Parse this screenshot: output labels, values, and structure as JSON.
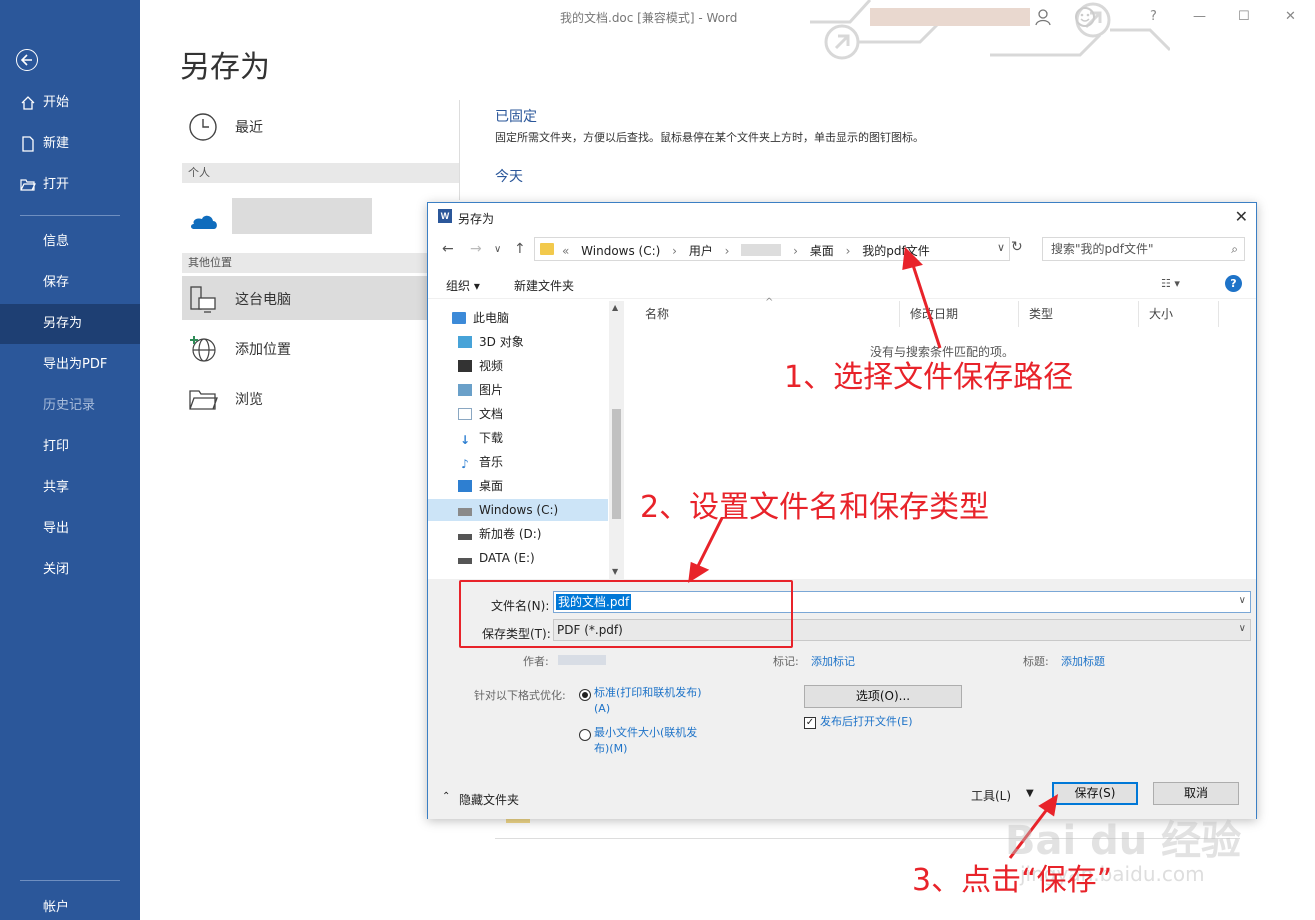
{
  "window": {
    "title": "我的文档.doc [兼容模式] - Word",
    "help": "?",
    "minimize": "—",
    "maximize": "☐",
    "close": "✕"
  },
  "sidebar": {
    "items": [
      {
        "label": "开始",
        "icon": "home-icon"
      },
      {
        "label": "新建",
        "icon": "new-doc-icon"
      },
      {
        "label": "打开",
        "icon": "open-folder-icon"
      },
      {
        "label": "信息"
      },
      {
        "label": "保存"
      },
      {
        "label": "另存为",
        "active": true
      },
      {
        "label": "导出为PDF"
      },
      {
        "label": "历史记录",
        "disabled": true
      },
      {
        "label": "打印"
      },
      {
        "label": "共享"
      },
      {
        "label": "导出"
      },
      {
        "label": "关闭"
      }
    ],
    "account": "帐户"
  },
  "backstage": {
    "title": "另存为",
    "recent": "最近",
    "personal_section": "个人",
    "other_section": "其他位置",
    "this_pc": "这台电脑",
    "add_place": "添加位置",
    "browse": "浏览",
    "pinned_title": "已固定",
    "pinned_desc": "固定所需文件夹，方便以后查找。鼠标悬停在某个文件夹上方时，单击显示的图钉图标。",
    "today_title": "今天"
  },
  "dialog": {
    "title": "另存为",
    "close": "✕",
    "breadcrumbs": [
      "«",
      "Windows (C:)",
      "›",
      "用户",
      "›",
      "›",
      "桌面",
      "›",
      "我的pdf文件"
    ],
    "search_placeholder": "搜索\"我的pdf文件\"",
    "toolbar": {
      "organize": "组织 ▾",
      "new_folder": "新建文件夹",
      "help": "?"
    },
    "tree": [
      {
        "label": "此电脑",
        "icon": "computer-icon",
        "color": "#3c8ad8"
      },
      {
        "label": "3D 对象",
        "icon": "cube-icon",
        "color": "#47a3d8"
      },
      {
        "label": "视频",
        "icon": "video-icon",
        "color": "#333333"
      },
      {
        "label": "图片",
        "icon": "picture-icon",
        "color": "#6aa0c9"
      },
      {
        "label": "文档",
        "icon": "document-icon",
        "color": "#8aa7c2"
      },
      {
        "label": "下载",
        "icon": "download-icon",
        "color": "#2e7fd1"
      },
      {
        "label": "音乐",
        "icon": "music-icon",
        "color": "#2e7fd1"
      },
      {
        "label": "桌面",
        "icon": "desktop-icon",
        "color": "#2e7fd1"
      },
      {
        "label": "Windows (C:)",
        "icon": "drive-icon",
        "color": "#8a8a8a",
        "selected": true
      },
      {
        "label": "新加卷 (D:)",
        "icon": "drive-icon",
        "color": "#555555"
      },
      {
        "label": "DATA (E:)",
        "icon": "drive-icon",
        "color": "#555555"
      }
    ],
    "columns": [
      "名称",
      "修改日期",
      "类型",
      "大小"
    ],
    "empty_message": "没有与搜索条件匹配的项。",
    "filename_label": "文件名(N):",
    "filename_value": "我的文档.pdf",
    "filetype_label": "保存类型(T):",
    "filetype_value": "PDF (*.pdf)",
    "author_label": "作者:",
    "tags_label": "标记:",
    "tags_link": "添加标记",
    "title_label": "标题:",
    "title_link": "添加标题",
    "optimize_label": "针对以下格式优化:",
    "opt_standard_1": "标准(打印和联机发布)",
    "opt_standard_2": "(A)",
    "opt_min_1": "最小文件大小(联机发",
    "opt_min_2": "布)(M)",
    "options_button": "选项(O)...",
    "open_after": "发布后打开文件(E)",
    "hide_folders": "隐藏文件夹",
    "tools": "工具(L)",
    "save": "保存(S)",
    "cancel": "取消"
  },
  "annotations": {
    "step1": "1、选择文件保存路径",
    "step2": "2、设置文件名和保存类型",
    "step3": "3、点击“保存”",
    "watermark": "Bai du 经验",
    "watermark_url": "jingyan.baidu.com"
  }
}
